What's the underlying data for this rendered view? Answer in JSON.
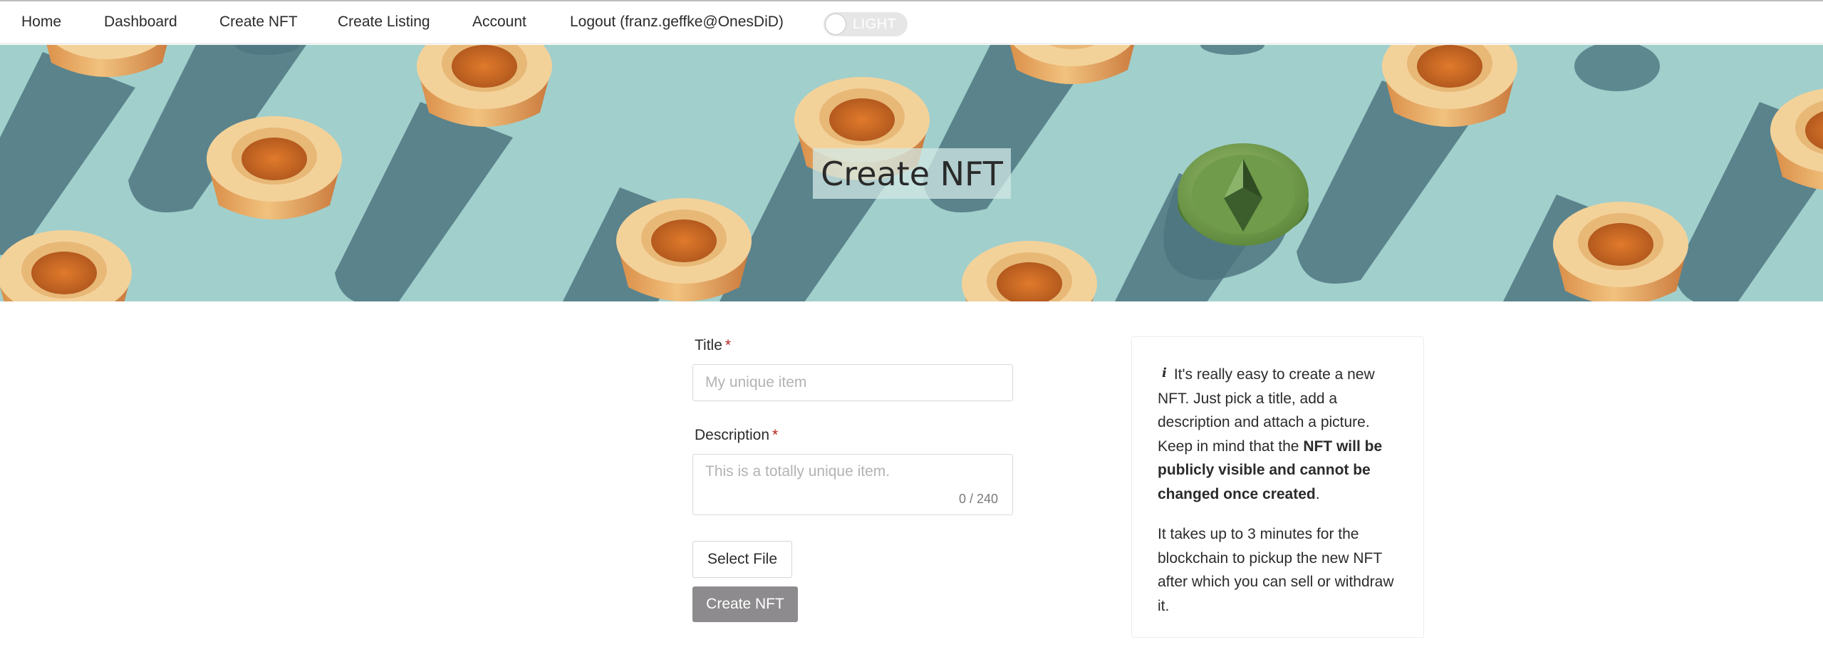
{
  "nav": {
    "home": "Home",
    "dashboard": "Dashboard",
    "create_nft": "Create NFT",
    "create_listing": "Create Listing",
    "account": "Account",
    "logout": "Logout (franz.geffke@OnesDiD)",
    "theme_toggle_label": "LIGHT"
  },
  "hero": {
    "title": "Create NFT"
  },
  "form": {
    "title_label": "Title",
    "title_required_mark": "*",
    "title_placeholder": "My unique item",
    "title_value": "",
    "description_label": "Description",
    "description_required_mark": "*",
    "description_placeholder": "This is a totally unique item.",
    "description_value": "",
    "description_counter": "0 / 240",
    "select_file_label": "Select File",
    "submit_label": "Create NFT"
  },
  "info": {
    "icon": "info-icon",
    "p1_start": "It's really easy to create a new NFT. Just pick a title, add a description and attach a picture. Keep in mind that the ",
    "p1_bold": "NFT will be publicly visible and cannot be changed once created",
    "p1_end": ".",
    "p2": "It takes up to 3 minutes for the blockchain to pickup the new NFT after which you can sell or withdraw it."
  },
  "colors": {
    "hero_background": "#a1cfcc",
    "primary_button": "#8d8b8d",
    "required_mark": "#b3261e",
    "toggle_track": "#e6e6e6"
  }
}
